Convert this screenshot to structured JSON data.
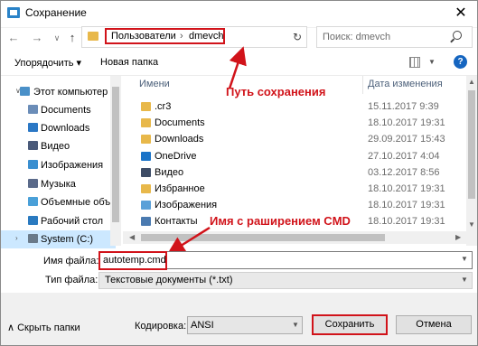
{
  "window": {
    "title": "Сохранение",
    "close_glyph": "✕"
  },
  "nav": {
    "back_glyph": "←",
    "forward_glyph": "→",
    "dropdown_glyph": "∨",
    "up_glyph": "↑",
    "breadcrumb": [
      "Пользователи",
      "dmevch"
    ],
    "crumb_sep": "›",
    "refresh_glyph": "↻",
    "search_placeholder": "Поиск: dmevch"
  },
  "toolbar": {
    "organize_label": "Упорядочить ▾",
    "new_folder_label": "Новая папка",
    "help_glyph": "?"
  },
  "sidebar": {
    "items": [
      {
        "label": "Этот компьютер",
        "icon": "computer-icon",
        "color": "#4a90c8"
      },
      {
        "label": "Documents",
        "icon": "documents-icon",
        "color": "#6b8db8"
      },
      {
        "label": "Downloads",
        "icon": "downloads-icon",
        "color": "#2b78c5"
      },
      {
        "label": "Видео",
        "icon": "video-icon",
        "color": "#4a5a7a"
      },
      {
        "label": "Изображения",
        "icon": "images-icon",
        "color": "#3a8fd0"
      },
      {
        "label": "Музыка",
        "icon": "music-icon",
        "color": "#5a6a8a"
      },
      {
        "label": "Объемные объе",
        "icon": "3d-objects-icon",
        "color": "#4aa0d8"
      },
      {
        "label": "Рабочий стол",
        "icon": "desktop-icon",
        "color": "#2a7ac0"
      },
      {
        "label": "System (C:)",
        "icon": "drive-icon",
        "color": "#6a7a8a"
      }
    ]
  },
  "list": {
    "col_name": "Имени",
    "col_date": "Дата изменения",
    "rows": [
      {
        "name": ".cr3",
        "date": "15.11.2017 9:39",
        "icon": "folder-icon"
      },
      {
        "name": "Documents",
        "date": "18.10.2017 19:31",
        "icon": "folder-icon"
      },
      {
        "name": "Downloads",
        "date": "29.09.2017 15:43",
        "icon": "folder-icon"
      },
      {
        "name": "OneDrive",
        "date": "27.10.2017 4:04",
        "icon": "onedrive-icon"
      },
      {
        "name": "Видео",
        "date": "03.12.2017 8:56",
        "icon": "video-icon"
      },
      {
        "name": "Избранное",
        "date": "18.10.2017 19:31",
        "icon": "favorites-icon"
      },
      {
        "name": "Изображения",
        "date": "18.10.2017 19:31",
        "icon": "images-icon"
      },
      {
        "name": "Контакты",
        "date": "18.10.2017 19:31",
        "icon": "contacts-icon"
      }
    ]
  },
  "annotations": {
    "path": "Путь сохранения",
    "filename": "Имя с раширением CMD",
    "color": "#d1131a"
  },
  "fields": {
    "filename_label": "Имя файла:",
    "filename_value": "autotemp.cmd",
    "filetype_label": "Тип файла:",
    "filetype_value": "Текстовые документы (*.txt)"
  },
  "footer": {
    "hide_folders": "∧ Скрыть папки",
    "encoding_label": "Кодировка:",
    "encoding_value": "ANSI",
    "save_label": "Сохранить",
    "cancel_label": "Отмена"
  }
}
